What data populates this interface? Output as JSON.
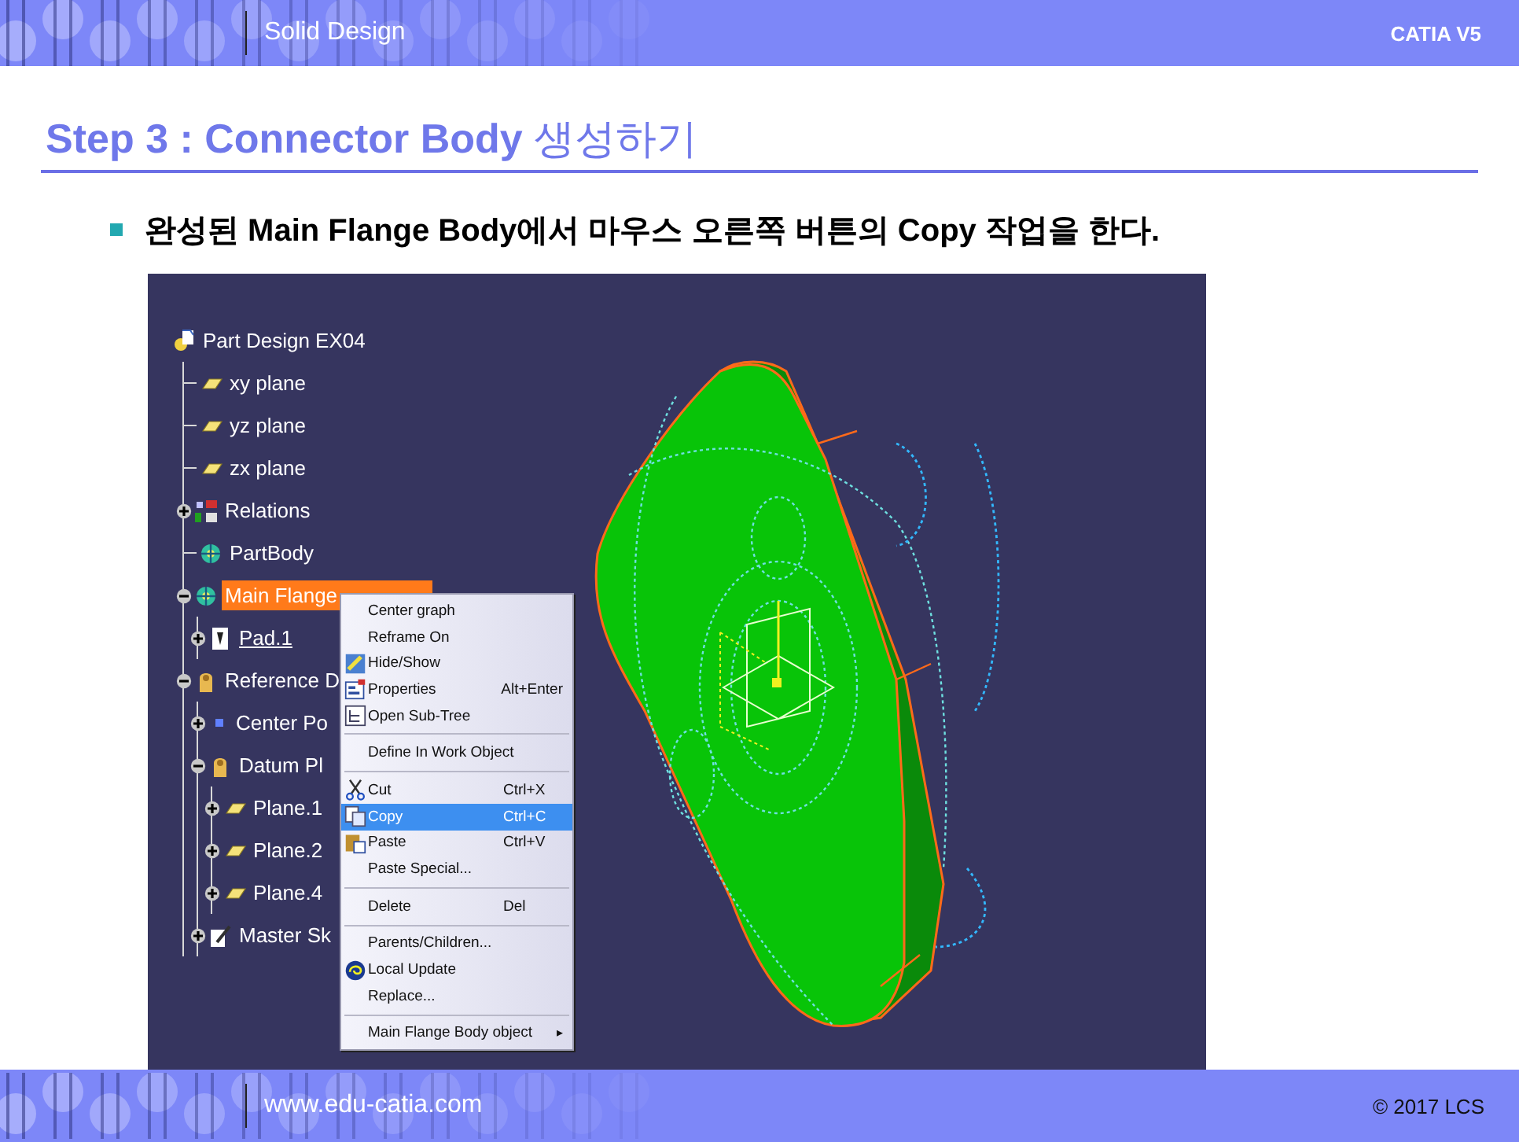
{
  "header": {
    "section": "Solid Design",
    "product": "CATIA V5"
  },
  "title": "**Step 3 : Connector Body** 생성하기",
  "bullet": "완성된 Main Flange Body에서 마우스 오른쪽 버튼의 Copy 작업을 한다.",
  "tree": [
    {
      "label": "Part Design EX04",
      "kind": "part",
      "selected": false,
      "children": [
        {
          "label": "xy plane",
          "kind": "plane",
          "selected": false
        },
        {
          "label": "yz plane",
          "kind": "plane",
          "selected": false
        },
        {
          "label": "zx plane",
          "kind": "plane",
          "selected": false
        },
        {
          "label": "Relations",
          "kind": "relations",
          "selected": false,
          "expanded": false
        },
        {
          "label": "PartBody",
          "kind": "body",
          "selected": false
        },
        {
          "label": "Main Flange",
          "kind": "body",
          "selected": true,
          "expanded": true,
          "children": [
            {
              "label": "Pad.1",
              "kind": "pad",
              "selected": false,
              "expanded": false,
              "current": true
            }
          ]
        },
        {
          "label": "Reference D",
          "kind": "geoset",
          "selected": false,
          "expanded": true,
          "children": [
            {
              "label": "Center Po",
              "kind": "point",
              "selected": false,
              "expanded": false
            },
            {
              "label": "Datum Pl",
              "kind": "geoset",
              "selected": false,
              "expanded": true,
              "children": [
                {
                  "label": "Plane.1",
                  "kind": "plane",
                  "selected": false,
                  "expanded": false
                },
                {
                  "label": "Plane.2",
                  "kind": "plane",
                  "selected": false,
                  "expanded": false
                },
                {
                  "label": "Plane.4",
                  "kind": "plane",
                  "selected": false,
                  "expanded": false
                }
              ]
            },
            {
              "label": "Master Sk",
              "kind": "sketch",
              "selected": false,
              "expanded": false
            }
          ]
        }
      ]
    }
  ],
  "context_menu": [
    [
      {
        "label": "Center graph",
        "selected": false
      },
      {
        "label": "Reframe On",
        "selected": false
      },
      {
        "label": "Hide/Show",
        "kind": "hide",
        "selected": false
      },
      {
        "label": "Properties",
        "kind": "properties",
        "shortcut": "Alt+Enter",
        "selected": false
      },
      {
        "label": "Open Sub-Tree",
        "kind": "subtree",
        "selected": false
      }
    ],
    [
      {
        "label": "Define In Work Object",
        "selected": false
      }
    ],
    [
      {
        "label": "Cut",
        "kind": "cut",
        "shortcut": "Ctrl+X",
        "selected": false
      },
      {
        "label": "Copy",
        "kind": "copy",
        "shortcut": "Ctrl+C",
        "selected": true
      },
      {
        "label": "Paste",
        "kind": "paste",
        "shortcut": "Ctrl+V",
        "selected": false
      },
      {
        "label": "Paste Special...",
        "selected": false
      }
    ],
    [
      {
        "label": "Delete",
        "shortcut": "Del",
        "selected": false
      }
    ],
    [
      {
        "label": "Parents/Children...",
        "selected": false
      },
      {
        "label": "Local Update",
        "kind": "update",
        "selected": false
      },
      {
        "label": "Replace...",
        "selected": false
      }
    ],
    [
      {
        "label": "Main Flange Body object",
        "submenu": "▸",
        "selected": false
      }
    ]
  ],
  "footer": {
    "site": "www.edu-catia.com",
    "copyright": "© 2017 LCS"
  }
}
